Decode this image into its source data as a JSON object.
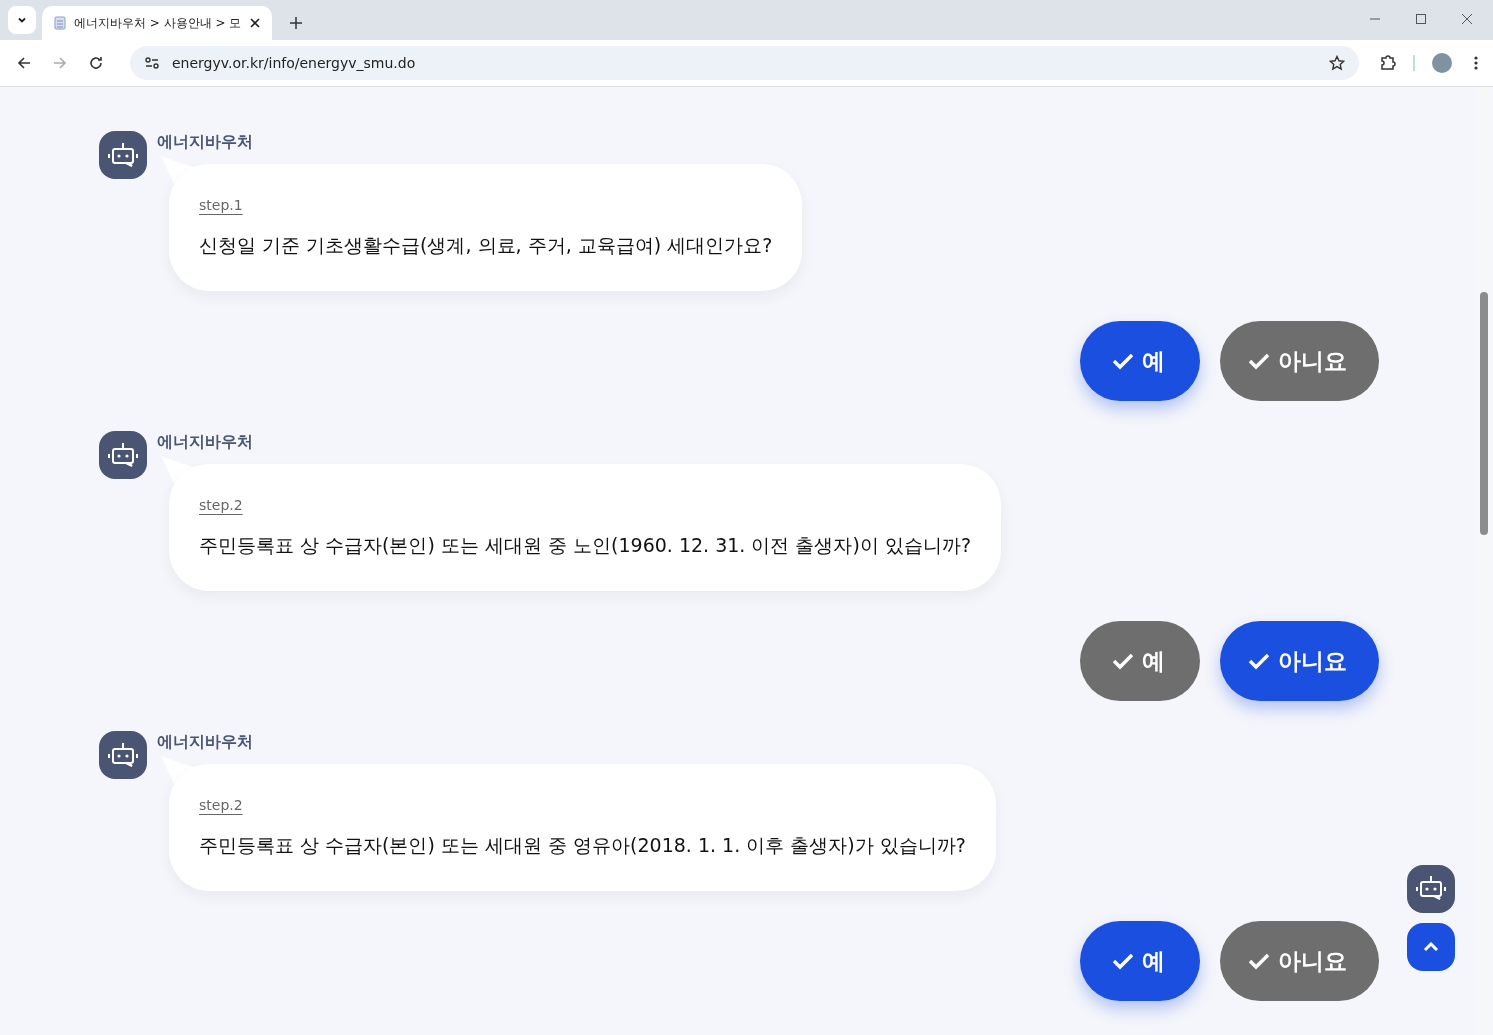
{
  "browser": {
    "tab_title": "에너지바우처 > 사용안내 > 모",
    "url": "energyv.or.kr/info/energyv_smu.do"
  },
  "steps": [
    {
      "bot_name": "에너지바우처",
      "step": "step.1",
      "question": "신청일 기준 기초생활수급(생계, 의료, 주거, 교육급여) 세대인가요?",
      "answers": [
        {
          "label": "예",
          "selected": true
        },
        {
          "label": "아니요",
          "selected": false
        }
      ]
    },
    {
      "bot_name": "에너지바우처",
      "step": "step.2",
      "question": "주민등록표 상 수급자(본인) 또는 세대원 중 노인(1960. 12. 31. 이전 출생자)이 있습니까?",
      "answers": [
        {
          "label": "예",
          "selected": false
        },
        {
          "label": "아니요",
          "selected": true
        }
      ]
    },
    {
      "bot_name": "에너지바우처",
      "step": "step.2",
      "question": "주민등록표 상 수급자(본인) 또는 세대원 중 영유아(2018. 1. 1. 이후 출생자)가 있습니까?",
      "answers": [
        {
          "label": "예",
          "selected": true
        },
        {
          "label": "아니요",
          "selected": false
        }
      ]
    }
  ]
}
